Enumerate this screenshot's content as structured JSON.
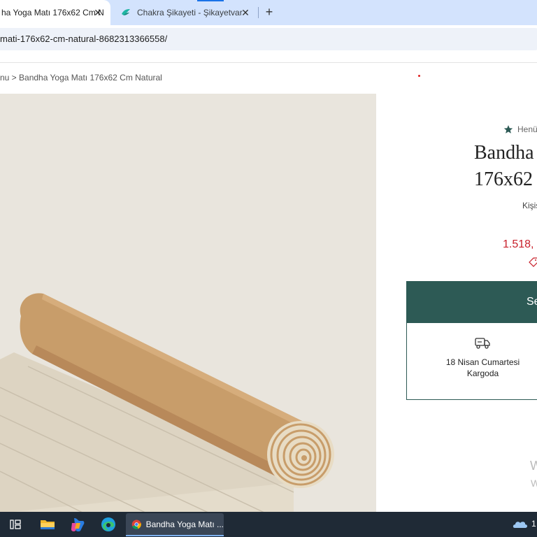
{
  "browser": {
    "tabs": [
      {
        "title": "ha Yoga Matı 176x62 Cm N",
        "active": true
      },
      {
        "title": "Chakra Şikayeti - Şikayetvar",
        "active": false
      }
    ],
    "new_tab_symbol": "+",
    "close_symbol": "✕",
    "url": "mati-176x62-cm-natural-8682313366558/"
  },
  "page": {
    "breadcrumb": "nu > Bandha Yoga Matı 176x62 Cm Natural",
    "rating_text": "Henü",
    "title_line1": "Bandha",
    "title_line2": "176x62",
    "personalize": "Kişis",
    "price": "1.518,",
    "cta_label": "Se",
    "shipping_text": "18 Nisan Cumartesi Kargoda",
    "faint_line1": "W",
    "faint_line2": "W"
  },
  "taskbar": {
    "chrome_label": "Bandha Yoga Matı ...",
    "tray_text": "1"
  },
  "colors": {
    "accent": "#2d5a55",
    "price": "#c8202b",
    "tabstrip": "#d3e3fd",
    "taskbar": "#1f2a36"
  }
}
